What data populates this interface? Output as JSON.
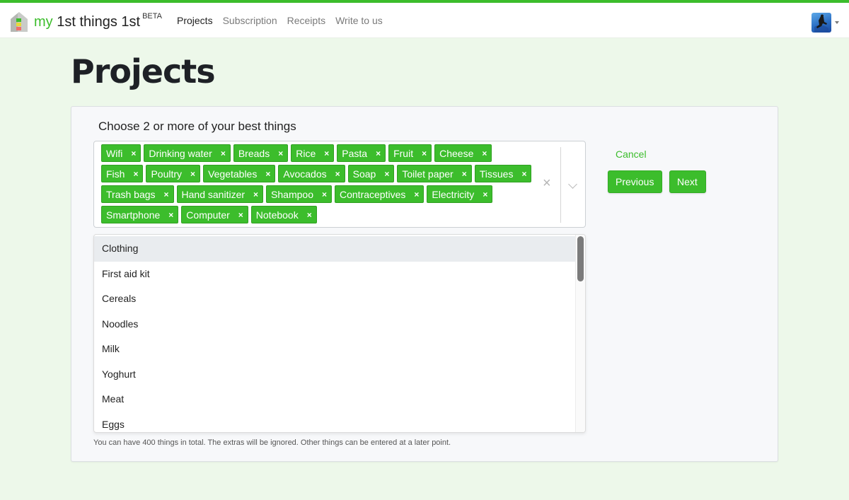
{
  "header": {
    "brand_prefix": "my",
    "brand_rest": " 1st things 1st",
    "brand_badge": "BETA",
    "logo_icon": "house-traffic-light-icon",
    "nav": [
      {
        "label": "Projects",
        "active": true
      },
      {
        "label": "Subscription",
        "active": false
      },
      {
        "label": "Receipts",
        "active": false
      },
      {
        "label": "Write to us",
        "active": false
      }
    ],
    "avatar_icon": "user-avatar"
  },
  "page": {
    "title": "Projects"
  },
  "form": {
    "prompt": "Choose 2 or more of your best things",
    "selected": [
      "Wifi",
      "Drinking water",
      "Breads",
      "Rice",
      "Pasta",
      "Fruit",
      "Cheese",
      "Fish",
      "Poultry",
      "Vegetables",
      "Avocados",
      "Soap",
      "Toilet paper",
      "Tissues",
      "Trash bags",
      "Hand sanitizer",
      "Shampoo",
      "Contraceptives",
      "Electricity",
      "Smartphone",
      "Computer",
      "Notebook"
    ],
    "remove_glyph": "×",
    "clear_glyph": "×",
    "options": [
      "Clothing",
      "First aid kit",
      "Cereals",
      "Noodles",
      "Milk",
      "Yoghurt",
      "Meat",
      "Eggs"
    ],
    "focused_option": "Clothing",
    "hint": "You can have 400 things in total. The extras will be ignored. Other things can be entered at a later point."
  },
  "actions": {
    "cancel": "Cancel",
    "previous": "Previous",
    "next": "Next"
  },
  "colors": {
    "accent": "#3cbd2c",
    "page_bg": "#edf8ea",
    "card_bg": "#f7f8fa"
  }
}
